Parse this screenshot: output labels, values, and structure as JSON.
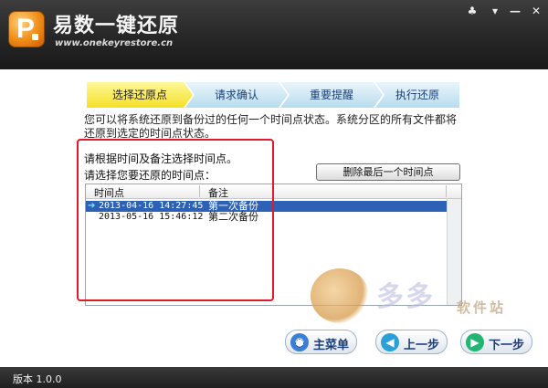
{
  "app": {
    "title": "易数一键还原",
    "url": "www.onekeyrestore.cn",
    "logo_letter": "P"
  },
  "window_buttons": {
    "skin": "♣",
    "menu": "▾",
    "minimize": "—",
    "close": "✕"
  },
  "steps": [
    {
      "label": "选择还原点",
      "active": true
    },
    {
      "label": "请求确认",
      "active": false
    },
    {
      "label": "重要提醒",
      "active": false
    },
    {
      "label": "执行还原",
      "active": false
    }
  ],
  "description": "您可以将系统还原到备份过的任何一个时间点状态。系统分区的所有文件都将还原到选定的时间点状态。",
  "hint": "请根据时间及备注选择时间点。",
  "sublabel": "请选择您要还原的时间点：",
  "delete_button": "删除最后一个时间点",
  "list": {
    "columns": [
      "时间点",
      "备注"
    ],
    "rows": [
      {
        "time": "2013-04-16 14:27:45",
        "note": "第一次备份",
        "selected": true
      },
      {
        "time": "2013-05-16 15:46:12",
        "note": "第二次备份",
        "selected": false
      }
    ]
  },
  "watermark": {
    "text": "多多",
    "sub": "软件站"
  },
  "nav": {
    "main_menu": "主菜单",
    "prev": "上一步",
    "next": "下一步"
  },
  "status": {
    "version": "版本 1.0.0"
  }
}
